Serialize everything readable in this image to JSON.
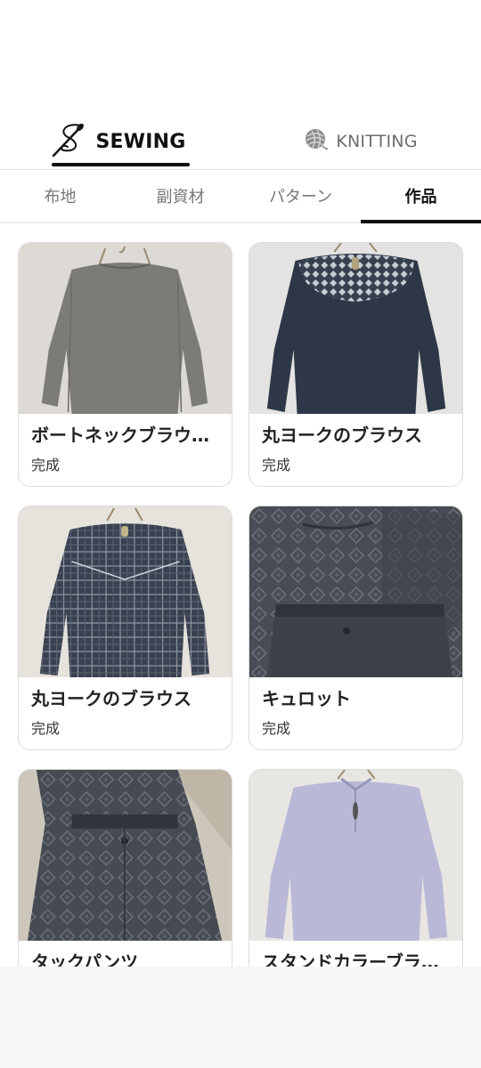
{
  "mode_tabs": [
    {
      "label": "SEWING",
      "icon": "needle-thread-icon",
      "active": true
    },
    {
      "label": "KNITTING",
      "icon": "yarn-ball-icon",
      "active": false
    }
  ],
  "category_tabs": [
    {
      "label": "布地",
      "active": false
    },
    {
      "label": "副資材",
      "active": false
    },
    {
      "label": "パターン",
      "active": false
    },
    {
      "label": "作品",
      "active": true
    }
  ],
  "works": [
    {
      "title": "ボートネックブラウ…",
      "status": "完成",
      "garment": "gray boat-neck blouse"
    },
    {
      "title": "丸ヨークのブラウス",
      "status": "完成",
      "garment": "navy blouse with patterned yoke"
    },
    {
      "title": "丸ヨークのブラウス",
      "status": "完成",
      "garment": "plaid blouse with yoke"
    },
    {
      "title": "キュロット",
      "status": "完成",
      "garment": "patterned culottes"
    },
    {
      "title": "タックパンツ",
      "status": "",
      "garment": "patterned tuck pants"
    },
    {
      "title": "スタンドカラーブラ…",
      "status": "",
      "garment": "lavender stand-collar blouse"
    }
  ],
  "colors": {
    "accent": "#111111",
    "inactive_text": "#777777",
    "card_border": "#dcdcdc"
  }
}
